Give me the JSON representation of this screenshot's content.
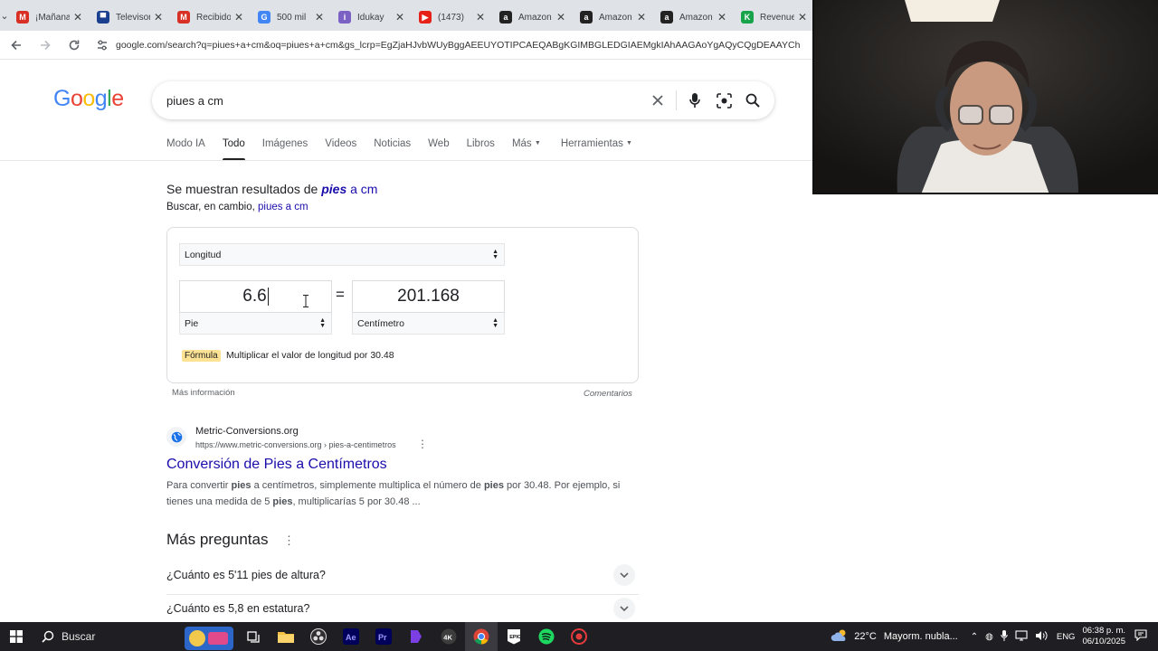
{
  "browser": {
    "tabs": [
      {
        "label": "¡Mañana",
        "icon": "gmail-icon",
        "color": "#d93025",
        "glyph": "M"
      },
      {
        "label": "Televisor",
        "icon": "doc-icon",
        "color": "#1a3f8f",
        "glyph": "▀"
      },
      {
        "label": "Recibidos",
        "icon": "gmail-icon",
        "color": "#d93025",
        "glyph": "M"
      },
      {
        "label": "500 mil",
        "icon": "google-icon",
        "color": "#4285f4",
        "glyph": "G"
      },
      {
        "label": "Idukay",
        "icon": "idukay-icon",
        "color": "#7b61c4",
        "glyph": "i"
      },
      {
        "label": "(1473)",
        "icon": "youtube-icon",
        "color": "#e62117",
        "glyph": "▶"
      },
      {
        "label": "Amazon",
        "icon": "amazon-icon",
        "color": "#222222",
        "glyph": "a"
      },
      {
        "label": "Amazon",
        "icon": "amazon-icon",
        "color": "#222222",
        "glyph": "a"
      },
      {
        "label": "Amazon",
        "icon": "amazon-icon",
        "color": "#222222",
        "glyph": "a"
      },
      {
        "label": "Revenue",
        "icon": "revenue-icon",
        "color": "#16a34a",
        "glyph": "K"
      }
    ],
    "url": "google.com/search?q=piues+a+cm&oq=piues+a+cm&gs_lcrp=EgZjaHJvbWUyBggAEEUYOTIPCAEQABgKGIMBGLEDGIAEMgkIAhAAGAoYgAQyCQgDEAAYCh"
  },
  "google": {
    "logo": "Google",
    "query": "piues a cm",
    "tabs": [
      "Modo IA",
      "Todo",
      "Imágenes",
      "Videos",
      "Noticias",
      "Web",
      "Libros",
      "Más",
      "Herramientas"
    ],
    "active_tab": "Todo"
  },
  "spelling": {
    "prefix": "Se muestran resultados de ",
    "corrected_bold": "pies",
    "corrected_rest": " a cm",
    "instead_prefix": "Buscar, en cambio, ",
    "original": "piues a cm"
  },
  "converter": {
    "category": "Longitud",
    "from_value": "6.6",
    "to_value": "201.168",
    "equals": "=",
    "from_unit": "Pie",
    "to_unit": "Centímetro",
    "formula_label": "Fórmula",
    "formula_text": "Multiplicar el valor de longitud por 30.48",
    "more_info": "Más información",
    "feedback": "Comentarios"
  },
  "result": {
    "site_name": "Metric-Conversions.org",
    "site_url": "https://www.metric-conversions.org › pies-a-centimetros",
    "title": "Conversión de Pies a Centímetros",
    "snippet_1a": "Para convertir ",
    "snippet_1b": "pies",
    "snippet_1c": " a centímetros, simplemente multiplica el número de ",
    "snippet_1d": "pies",
    "snippet_1e": " por 30.48. Por ejemplo, si",
    "snippet_2a": "tienes una medida de 5 ",
    "snippet_2b": "pies",
    "snippet_2c": ", multiplicarías 5 por 30.48 ..."
  },
  "paa": {
    "title": "Más preguntas",
    "questions": [
      "¿Cuánto es 5'11 pies de altura?",
      "¿Cuánto es 5,8 en estatura?"
    ]
  },
  "taskbar": {
    "search": "Buscar",
    "weather_temp": "22°C",
    "weather_desc": "Mayorm. nubla...",
    "language": "ENG",
    "time": "06:38 p. m.",
    "date": "06/10/2025",
    "app_icons": [
      "task-view-icon",
      "file-explorer-icon",
      "obs-icon",
      "after-effects-icon",
      "premiere-icon",
      "app-purple-icon",
      "4k-downloader-icon",
      "chrome-icon",
      "epic-games-icon",
      "spotify-icon",
      "app-red-icon"
    ]
  }
}
